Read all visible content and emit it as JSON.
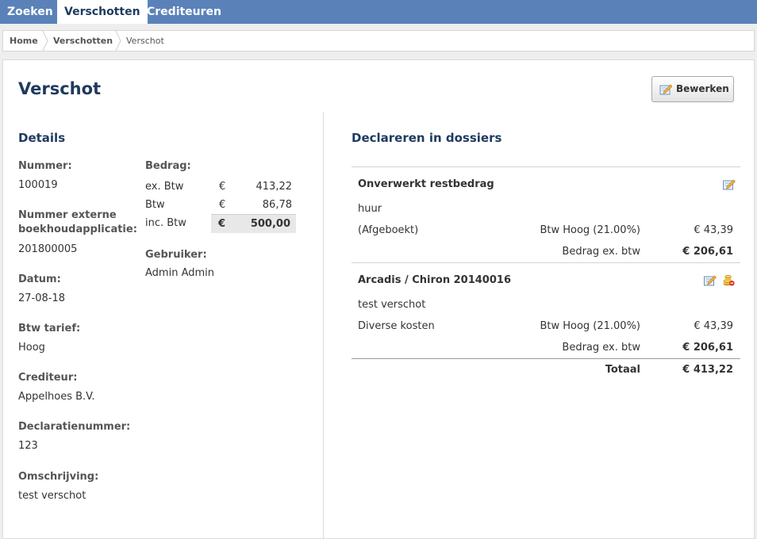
{
  "nav": {
    "tabs": [
      {
        "label": "Zoeken"
      },
      {
        "label": "Verschotten"
      },
      {
        "label": "Crediteuren"
      }
    ]
  },
  "breadcrumb": {
    "home": "Home",
    "section": "Verschotten",
    "current": "Verschot"
  },
  "page": {
    "title": "Verschot",
    "edit_label": "Bewerken"
  },
  "details": {
    "heading": "Details",
    "nummer_label": "Nummer:",
    "nummer_value": "100019",
    "extern_label_1": "Nummer externe",
    "extern_label_2": "boekhoudapplicatie:",
    "extern_value": "201800005",
    "datum_label": "Datum:",
    "datum_value": "27-08-18",
    "btw_label": "Btw tarief:",
    "btw_value": "Hoog",
    "crediteur_label": "Crediteur:",
    "crediteur_value": "Appelhoes B.V.",
    "declaratie_label": "Declaratienummer:",
    "declaratie_value": "123",
    "omschrijving_label": "Omschrijving:",
    "omschrijving_value": "test verschot",
    "bedrag_label": "Bedrag:",
    "amounts": [
      {
        "label": "ex. Btw",
        "currency": "€",
        "value": "413,22"
      },
      {
        "label": "Btw",
        "currency": "€",
        "value": "86,78"
      },
      {
        "label": "inc. Btw",
        "currency": "€",
        "value": "500,00"
      }
    ],
    "gebruiker_label": "Gebruiker:",
    "gebruiker_value": "Admin Admin"
  },
  "dossiers": {
    "heading": "Declareren in dossiers",
    "items": [
      {
        "title": "Onverwerkt restbedrag",
        "description": "huur",
        "line_label": "(Afgeboekt)",
        "tax": "Btw Hoog (21.00%)",
        "tax_amount": "€ 43,39",
        "subtotal_label": "Bedrag ex. btw",
        "subtotal": "€ 206,61"
      },
      {
        "title": "Arcadis / Chiron 20140016",
        "description": "test verschot",
        "line_label": "Diverse kosten",
        "tax": "Btw Hoog (21.00%)",
        "tax_amount": "€ 43,39",
        "subtotal_label": "Bedrag ex. btw",
        "subtotal": "€ 206,61"
      }
    ],
    "total_label": "Totaal",
    "total_value": "€ 413,22"
  }
}
